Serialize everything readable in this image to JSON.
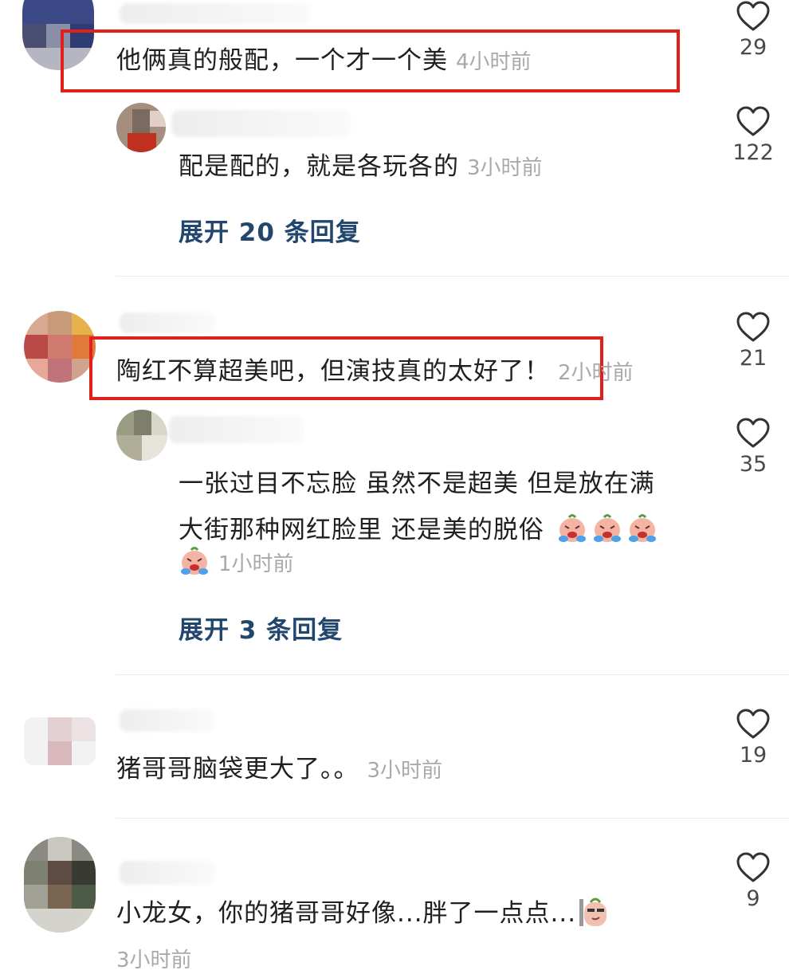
{
  "comments": [
    {
      "text": "他俩真的般配，一个才一个美",
      "time": "4小时前",
      "likes": "29",
      "highlighted": true,
      "reply": {
        "text": "配是配的，就是各玩各的",
        "time": "3小时前",
        "likes": "122"
      },
      "expand_label": "展开 20 条回复"
    },
    {
      "text": "陶红不算超美吧，但演技真的太好了！",
      "time": "2小时前",
      "likes": "21",
      "highlighted": true,
      "reply": {
        "text_line1": "一张过目不忘脸 虽然不是超美 但是放在满",
        "text_line2": "大街那种网红脸里 还是美的脱俗",
        "time": "1小时前",
        "likes": "35",
        "emoji": "crying-face-emoji"
      },
      "expand_label": "展开 3 条回复"
    },
    {
      "text": "猪哥哥脑袋更大了。。",
      "time": "3小时前",
      "likes": "19",
      "highlighted": false
    },
    {
      "text": "小龙女，你的猪哥哥好像...胖了一点点...",
      "time": "3小时前",
      "likes": "9",
      "highlighted": false,
      "emoji": "smirk-face-emoji"
    }
  ],
  "colors": {
    "highlight": "#e0201a",
    "expand_link": "#22466e",
    "time": "#a9a9a9"
  },
  "icons": {
    "like": "heart-outline-icon"
  }
}
